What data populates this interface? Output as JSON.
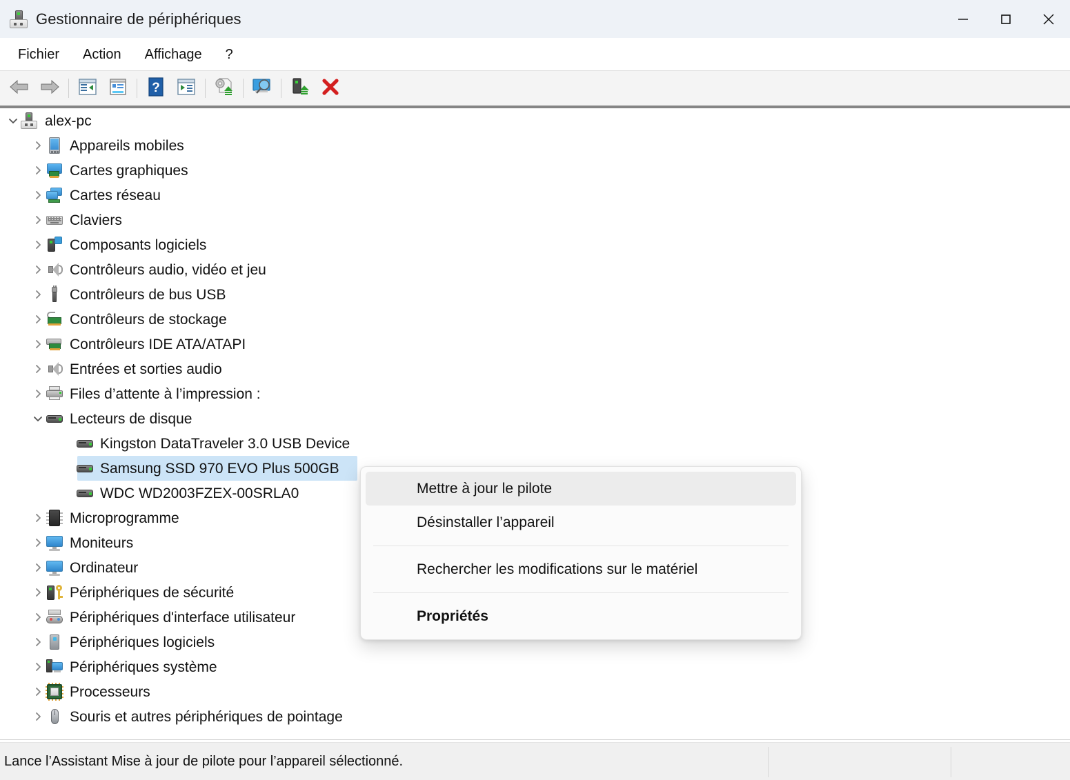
{
  "window": {
    "title": "Gestionnaire de périphériques",
    "app_icon": "computer-device-icon",
    "controls": {
      "minimize": "minimize-icon",
      "maximize": "maximize-icon",
      "close": "close-icon"
    }
  },
  "menubar": {
    "items": [
      {
        "label": "Fichier"
      },
      {
        "label": "Action"
      },
      {
        "label": "Affichage"
      },
      {
        "label": "?"
      }
    ]
  },
  "toolbar": {
    "buttons": [
      {
        "name": "back-button",
        "icon": "back-arrow-icon"
      },
      {
        "name": "forward-button",
        "icon": "forward-arrow-icon"
      },
      {
        "name": "show-hide-console-tree-button",
        "icon": "console-tree-icon"
      },
      {
        "name": "properties-button",
        "icon": "properties-icon"
      },
      {
        "name": "help-button",
        "icon": "help-question-icon"
      },
      {
        "name": "show-hide-action-pane-button",
        "icon": "action-pane-icon"
      },
      {
        "name": "update-driver-button",
        "icon": "update-driver-icon"
      },
      {
        "name": "scan-hardware-changes-button",
        "icon": "scan-monitor-icon"
      },
      {
        "name": "enable-device-button",
        "icon": "enable-device-icon"
      },
      {
        "name": "uninstall-device-button",
        "icon": "red-x-icon"
      }
    ]
  },
  "tree": {
    "root": {
      "label": "alex-pc",
      "icon": "computer-icon",
      "expanded": true,
      "chevron": "chevron-down"
    },
    "items": [
      {
        "label": "Appareils mobiles",
        "icon": "mobile-device-icon",
        "depth": 1,
        "expanded": false
      },
      {
        "label": "Cartes graphiques",
        "icon": "display-adapter-icon",
        "depth": 1,
        "expanded": false
      },
      {
        "label": "Cartes réseau",
        "icon": "network-adapter-icon",
        "depth": 1,
        "expanded": false
      },
      {
        "label": "Claviers",
        "icon": "keyboard-icon",
        "depth": 1,
        "expanded": false
      },
      {
        "label": "Composants logiciels",
        "icon": "software-component-icon",
        "depth": 1,
        "expanded": false
      },
      {
        "label": "Contrôleurs audio, vidéo et jeu",
        "icon": "speaker-icon",
        "depth": 1,
        "expanded": false
      },
      {
        "label": "Contrôleurs de bus USB",
        "icon": "usb-icon",
        "depth": 1,
        "expanded": false
      },
      {
        "label": "Contrôleurs de stockage",
        "icon": "storage-controller-icon",
        "depth": 1,
        "expanded": false
      },
      {
        "label": "Contrôleurs IDE ATA/ATAPI",
        "icon": "ide-controller-icon",
        "depth": 1,
        "expanded": false
      },
      {
        "label": "Entrées et sorties audio",
        "icon": "speaker-icon",
        "depth": 1,
        "expanded": false
      },
      {
        "label": "Files d’attente à l’impression :",
        "icon": "printer-icon",
        "depth": 1,
        "expanded": false
      },
      {
        "label": "Lecteurs de disque",
        "icon": "disk-drive-icon",
        "depth": 1,
        "expanded": true
      },
      {
        "label": "Kingston DataTraveler 3.0 USB Device",
        "icon": "disk-drive-icon",
        "depth": 2,
        "leaf": true
      },
      {
        "label": "Samsung SSD 970 EVO Plus 500GB",
        "icon": "disk-drive-icon",
        "depth": 2,
        "leaf": true,
        "selected": true
      },
      {
        "label": "WDC WD2003FZEX-00SRLA0",
        "icon": "disk-drive-icon",
        "depth": 2,
        "leaf": true
      },
      {
        "label": "Microprogramme",
        "icon": "firmware-chip-icon",
        "depth": 1,
        "expanded": false
      },
      {
        "label": "Moniteurs",
        "icon": "monitor-icon",
        "depth": 1,
        "expanded": false
      },
      {
        "label": "Ordinateur",
        "icon": "monitor-icon",
        "depth": 1,
        "expanded": false
      },
      {
        "label": "Périphériques de sécurité",
        "icon": "security-device-icon",
        "depth": 1,
        "expanded": false
      },
      {
        "label": "Périphériques d'interface utilisateur",
        "icon": "hid-icon",
        "depth": 1,
        "expanded": false
      },
      {
        "label": "Périphériques logiciels",
        "icon": "software-device-icon",
        "depth": 1,
        "expanded": false
      },
      {
        "label": "Périphériques système",
        "icon": "system-device-icon",
        "depth": 1,
        "expanded": false
      },
      {
        "label": "Processeurs",
        "icon": "processor-icon",
        "depth": 1,
        "expanded": false
      },
      {
        "label": "Souris et autres périphériques de pointage",
        "icon": "mouse-icon",
        "depth": 1,
        "expanded": false
      }
    ],
    "selection_color": "#cce4f7"
  },
  "context_menu": {
    "items": [
      {
        "label": "Mettre à jour le pilote",
        "highlighted": true
      },
      {
        "label": "Désinstaller l’appareil"
      },
      {
        "label": "Rechercher les modifications sur le matériel"
      },
      {
        "label": "Propriétés",
        "bold": true
      }
    ]
  },
  "statusbar": {
    "text": "Lance l’Assistant Mise à jour de pilote pour l’appareil sélectionné."
  }
}
